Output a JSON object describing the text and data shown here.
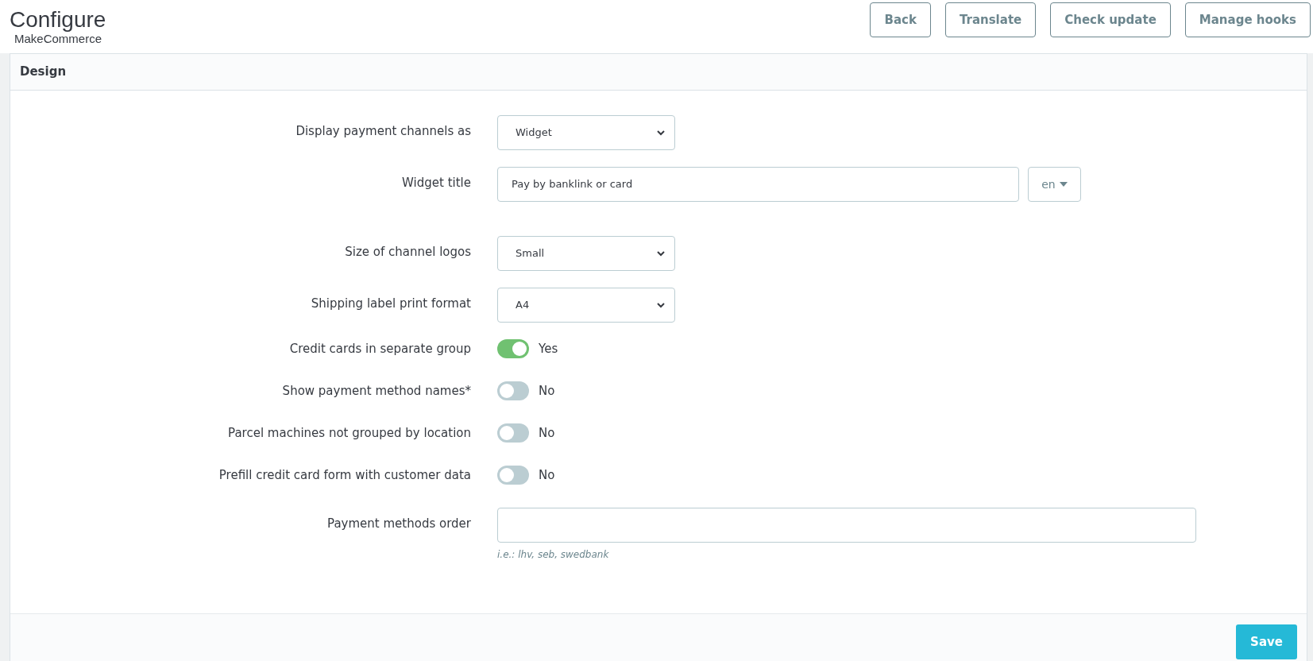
{
  "header": {
    "title": "Configure",
    "subtitle": "MakeCommerce",
    "buttons": [
      "Back",
      "Translate",
      "Check update",
      "Manage hooks"
    ]
  },
  "panel": {
    "title": "Design",
    "fields": [
      {
        "kind": "select",
        "label": "Display payment channels as",
        "value": "Widget"
      },
      {
        "kind": "translatable",
        "label": "Widget title",
        "value": "Pay by banklink or card",
        "language": "en"
      },
      {
        "kind": "select",
        "label": "Size of channel logos",
        "value": "Small"
      },
      {
        "kind": "select",
        "label": "Shipping label print format",
        "value": "A4"
      },
      {
        "kind": "toggle",
        "label": "Credit cards in separate group",
        "on": true,
        "state_text": "Yes"
      },
      {
        "kind": "toggle",
        "label": "Show payment method names*",
        "on": false,
        "state_text": "No"
      },
      {
        "kind": "toggle",
        "label": "Parcel machines not grouped by location",
        "on": false,
        "state_text": "No"
      },
      {
        "kind": "toggle",
        "label": "Prefill credit card form with customer data",
        "on": false,
        "state_text": "No"
      },
      {
        "kind": "text",
        "label": "Payment methods order",
        "help": "i.e.: lhv, seb, swedbank"
      }
    ],
    "save_button": "Save"
  }
}
